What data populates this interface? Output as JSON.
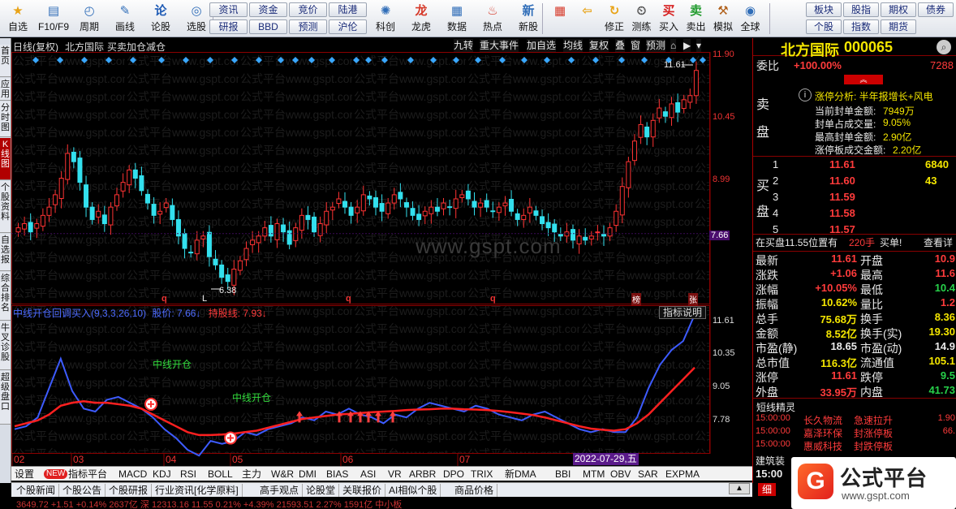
{
  "toolbar": {
    "buttons": [
      {
        "label": "自选",
        "icon": "star-icon"
      },
      {
        "label": "F10/F9",
        "icon": "f10-icon"
      },
      {
        "label": "周期",
        "icon": "clock-icon"
      },
      {
        "label": "画线",
        "icon": "pen-icon"
      },
      {
        "label": "论股",
        "icon": "forum-icon"
      },
      {
        "label": "选股",
        "icon": "pick-icon"
      }
    ],
    "small_buttons": [
      "资讯",
      "资金",
      "竞价",
      "陆港",
      "研报",
      "BBD",
      "预测",
      "沪伦"
    ],
    "buttons2": [
      {
        "label": "科创",
        "icon": "science-icon"
      },
      {
        "label": "龙虎",
        "icon": "dragon-icon"
      },
      {
        "label": "数据",
        "icon": "data-icon"
      },
      {
        "label": "热点",
        "icon": "hot-icon"
      },
      {
        "label": "新股",
        "icon": "newstock-icon"
      }
    ],
    "buttons3": [
      {
        "label": "",
        "icon": "grid-icon"
      },
      {
        "label": "",
        "icon": "back-icon"
      },
      {
        "label": "修正",
        "icon": "fix-icon"
      },
      {
        "label": "测练",
        "icon": "practice-icon"
      },
      {
        "label": "买入",
        "icon": "buy-icon"
      },
      {
        "label": "卖出",
        "icon": "sell-icon"
      },
      {
        "label": "模拟",
        "icon": "simulate-icon"
      },
      {
        "label": "全球",
        "icon": "globe-icon"
      }
    ],
    "small_buttons2": [
      "板块",
      "股指",
      "期权",
      "债券",
      "个股",
      "指数",
      "期货"
    ]
  },
  "left_tabs": [
    "首页",
    "应用",
    "分时图",
    "K线图",
    "个股资料",
    "自选报",
    "综合排名",
    "牛叉诊股",
    "超级盘口"
  ],
  "chart": {
    "header_title": "日线(复权)",
    "header_stock": "北方国际",
    "header_strategy": "买卖加仓减仓",
    "header_buttons": [
      "九转",
      "重大事件",
      "加自选",
      "均线",
      "复权",
      "叠",
      "窗",
      "预测"
    ],
    "y_labels": [
      "11.90",
      "10.45",
      "8.99",
      "7.66"
    ],
    "price_max_label": "11.61",
    "price_min_label": "6.38",
    "markers": [
      "q",
      "L",
      "q",
      "q",
      "榜",
      "张"
    ],
    "watermark_main": "www.gspt.com",
    "watermark_repeat": "公式平台www.gspt.com"
  },
  "indicator": {
    "title": "中线开仓回调买入(9,3,3,26,10)",
    "price_label": "股价: 7.66↓",
    "hold_label": "持股线: 7.93↓",
    "explain_button": "指标说明",
    "y_labels": [
      "11.61",
      "10.35",
      "9.05",
      "7.78"
    ],
    "signal_label_1": "中线开仓",
    "signal_label_2": "中线开仓",
    "date_label": "2022-07-29,五",
    "x_labels": [
      "02",
      "03",
      "04",
      "05",
      "06",
      "07"
    ]
  },
  "bottom_tabs": [
    "设置",
    "NEW",
    "指标平台",
    "MACD",
    "KDJ",
    "RSI",
    "BOLL",
    "主力",
    "W&R",
    "DMI",
    "BIAS",
    "ASI",
    "VR",
    "ARBR",
    "DPO",
    "TRIX",
    "新DMA",
    "BBI",
    "MTM",
    "OBV",
    "SAR",
    "EXPMA"
  ],
  "news_tabs": [
    "个股新闻",
    "个股公告",
    "个股研报",
    "行业资讯[化学原料]",
    "高手观点",
    "论股堂",
    "关联报价",
    "AI相似个股",
    "商品价格"
  ],
  "right_panel": {
    "stock_name": "北方国际",
    "stock_code": "000065",
    "weibi_label": "委比",
    "weibi_value": "+100.00%",
    "weibi_diff": "7288",
    "sell_label_1": "卖",
    "sell_label_2": "盘",
    "buy_label_1": "买",
    "buy_label_2": "盘",
    "limit_analysis": {
      "title": "涨停分析: 半年报增长+风电",
      "rows": [
        {
          "k": "当前封单金额:",
          "v": "7949万"
        },
        {
          "k": "封单占成交量:",
          "v": "9.05%"
        },
        {
          "k": "最高封单金额:",
          "v": "2.90亿"
        },
        {
          "k": "涨停板成交金额:",
          "v": "2.20亿"
        }
      ]
    },
    "bids": [
      {
        "n": "1",
        "p": "11.61",
        "v": "6840"
      },
      {
        "n": "2",
        "p": "11.60",
        "v": "43"
      },
      {
        "n": "3",
        "p": "11.59",
        "v": ""
      },
      {
        "n": "4",
        "p": "11.58",
        "v": ""
      },
      {
        "n": "5",
        "p": "11.57",
        "v": ""
      }
    ],
    "bid_note_prefix": "在买盘11.55位置有",
    "bid_note_volume": "220手",
    "bid_note_suffix": "买单!",
    "bid_note_link": "查看详",
    "quote_rows": [
      {
        "k1": "最新",
        "v1": "11.61",
        "c1": "red",
        "k2": "开盘",
        "v2": "10.9",
        "c2": "red"
      },
      {
        "k1": "涨跌",
        "v1": "+1.06",
        "c1": "red",
        "k2": "最高",
        "v2": "11.6",
        "c2": "red"
      },
      {
        "k1": "涨幅",
        "v1": "+10.05%",
        "c1": "red",
        "k2": "最低",
        "v2": "10.4",
        "c2": "green"
      },
      {
        "k1": "振幅",
        "v1": "10.62%",
        "c1": "yellow",
        "k2": "量比",
        "v2": "1.2",
        "c2": "red"
      },
      {
        "k1": "总手",
        "v1": "75.68万",
        "c1": "yellow",
        "k2": "换手",
        "v2": "8.36",
        "c2": "yellow"
      },
      {
        "k1": "金额",
        "v1": "8.52亿",
        "c1": "yellow",
        "k2": "换手(实)",
        "v2": "19.30",
        "c2": "yellow"
      },
      {
        "k1": "市盈(静)",
        "v1": "18.65",
        "c1": "white",
        "k2": "市盈(动)",
        "v2": "14.9",
        "c2": "white"
      },
      {
        "k1": "总市值",
        "v1": "116.3亿",
        "c1": "yellow",
        "k2": "流通值",
        "v2": "105.1",
        "c2": "yellow"
      },
      {
        "k1": "涨停",
        "v1": "11.61",
        "c1": "red",
        "k2": "跌停",
        "v2": "9.5",
        "c2": "green"
      },
      {
        "k1": "外盘",
        "v1": "33.95万",
        "c1": "red",
        "k2": "内盘",
        "v2": "41.73",
        "c2": "green"
      }
    ],
    "sprite_title": "短线精灵",
    "sprites": [
      {
        "t": "15:00:00",
        "name": "长久物流",
        "evt": "急速拉升",
        "val": "1.90"
      },
      {
        "t": "15:00:00",
        "name": "嘉泽环保",
        "evt": "封涨停板",
        "val": "66."
      },
      {
        "t": "15:00:00",
        "name": "惠威科技",
        "evt": "封跌停板",
        "val": ""
      }
    ],
    "bottom_label": "建筑装",
    "bottom_time": "15:00",
    "tab_detail": "细"
  },
  "logo": {
    "mark": "G",
    "name": "公式平台",
    "url": "www.gspt.com"
  },
  "status_bar": "3649.72  +1.51  +0.14%  2637亿  深  12313.16  11.55  0.21%  +4.39%  21593.51  2.27%  1591亿  中小板"
}
